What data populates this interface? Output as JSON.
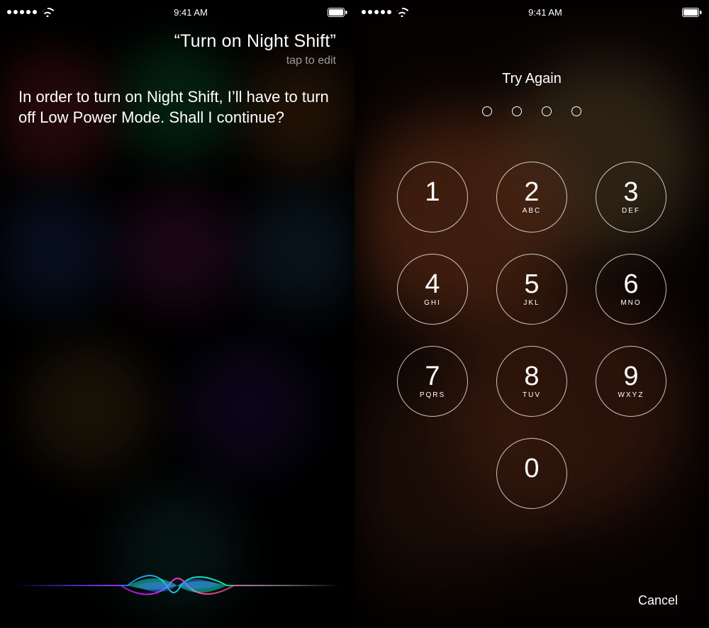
{
  "status": {
    "time": "9:41 AM"
  },
  "siri": {
    "query": "“Turn on Night Shift”",
    "tap_to_edit": "tap to edit",
    "response": "In order to turn on Night Shift, I’ll have to turn off Low Power Mode. Shall I continue?"
  },
  "passcode": {
    "title": "Try Again",
    "dots_count": 4,
    "cancel": "Cancel",
    "keys": [
      {
        "num": "1",
        "letters": ""
      },
      {
        "num": "2",
        "letters": "ABC"
      },
      {
        "num": "3",
        "letters": "DEF"
      },
      {
        "num": "4",
        "letters": "GHI"
      },
      {
        "num": "5",
        "letters": "JKL"
      },
      {
        "num": "6",
        "letters": "MNO"
      },
      {
        "num": "7",
        "letters": "PQRS"
      },
      {
        "num": "8",
        "letters": "TUV"
      },
      {
        "num": "9",
        "letters": "WXYZ"
      },
      {
        "num": "0",
        "letters": ""
      }
    ]
  }
}
